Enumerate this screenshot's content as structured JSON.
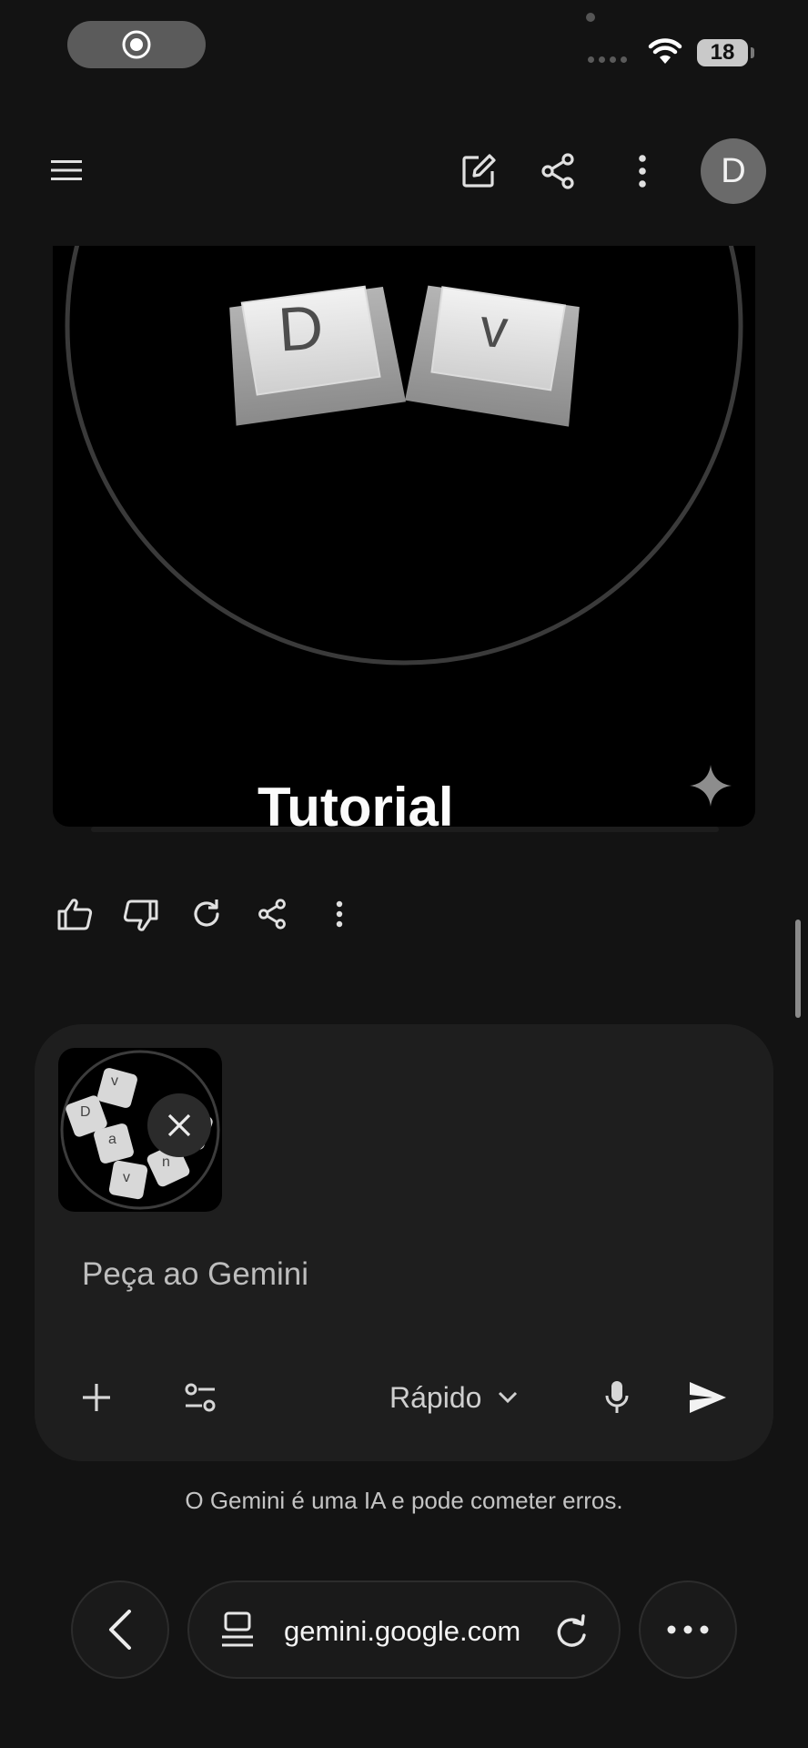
{
  "status_bar": {
    "battery_level": "18"
  },
  "header": {
    "avatar_letter": "D"
  },
  "image_card": {
    "keycap_left": "D",
    "keycap_right": "v",
    "title": "Tutorial"
  },
  "composer": {
    "attachment_keycaps": [
      "v",
      "D",
      "a",
      "t",
      "n",
      "v"
    ],
    "placeholder": "Peça ao Gemini",
    "mode_label": "Rápido"
  },
  "disclaimer": "O Gemini é uma IA e pode cometer erros.",
  "browser": {
    "url": "gemini.google.com"
  },
  "colors": {
    "background": "#131313",
    "composer_bg": "#1e1e1e",
    "card_bg": "#000000",
    "avatar_bg": "#6a6a6a"
  }
}
